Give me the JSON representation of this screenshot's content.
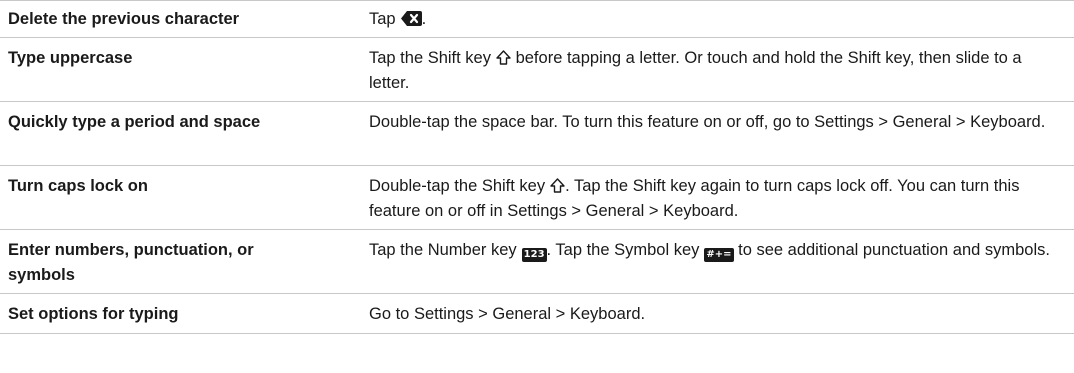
{
  "rows": [
    {
      "task": "Delete the previous character",
      "action": {
        "before": "Tap",
        "icon": "delete-key-icon",
        "after": "."
      }
    },
    {
      "task": "Type uppercase",
      "action": {
        "before": "Tap the Shift key",
        "icon": "shift-key-icon",
        "after": " before tapping a letter. Or touch and hold the Shift key, then slide to a letter."
      }
    },
    {
      "task": "Quickly type a period and space",
      "action": {
        "before": "Double-tap the space bar. To turn this feature on or off, go to Settings > General > Keyboard.",
        "icon": "",
        "after": ""
      }
    },
    {
      "task": "Turn caps lock on",
      "action": {
        "before": "Double-tap the Shift key",
        "icon": "shift-key-icon",
        "after": ". Tap the Shift key again to turn caps lock off. You can turn this feature on or off in Settings > General > Keyboard."
      }
    },
    {
      "task": "Enter numbers, punctuation, or symbols",
      "action": {
        "before": "Tap the Number key",
        "number_key_label": "123",
        "middle": ". Tap the Symbol key",
        "symbol_key_label": "#+=",
        "after": " to see additional punctuation and symbols."
      }
    },
    {
      "task": "Set options for typing",
      "action": {
        "before": "Go to Settings > General > Keyboard.",
        "icon": "",
        "after": ""
      }
    }
  ]
}
